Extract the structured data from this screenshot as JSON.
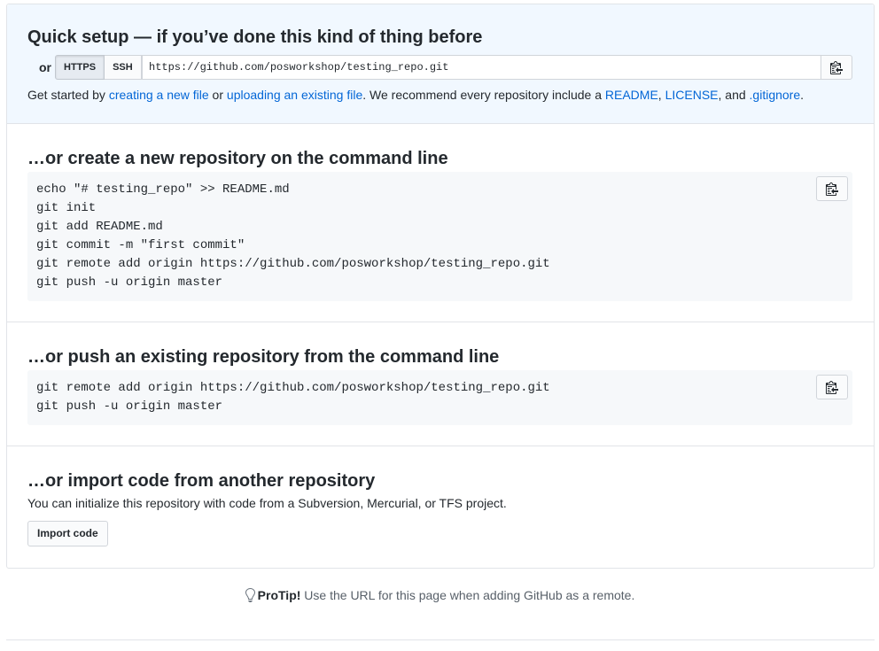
{
  "quick_setup": {
    "title": "Quick setup — if you’ve done this kind of thing before",
    "or_label": "or",
    "https_label": "HTTPS",
    "ssh_label": "SSH",
    "clone_url": "https://github.com/posworkshop/testing_repo.git",
    "get_started": {
      "prefix": "Get started by ",
      "new_file_link": "creating a new file",
      "or_text": " or ",
      "upload_link": "uploading an existing file",
      "recommend_text": ". We recommend every repository include a ",
      "readme_link": "README",
      "comma1": ", ",
      "license_link": "LICENSE",
      "and_text": ", and ",
      "gitignore_link": ".gitignore",
      "period": "."
    }
  },
  "create_section": {
    "title": "…or create a new repository on the command line",
    "code": "echo \"# testing_repo\" >> README.md\ngit init\ngit add README.md\ngit commit -m \"first commit\"\ngit remote add origin https://github.com/posworkshop/testing_repo.git\ngit push -u origin master"
  },
  "push_section": {
    "title": "…or push an existing repository from the command line",
    "code": "git remote add origin https://github.com/posworkshop/testing_repo.git\ngit push -u origin master"
  },
  "import_section": {
    "title": "…or import code from another repository",
    "description": "You can initialize this repository with code from a Subversion, Mercurial, or TFS project.",
    "button_label": "Import code"
  },
  "protip": {
    "label": "ProTip!",
    "text": " Use the URL for this page when adding GitHub as a remote."
  },
  "icons": {
    "copy": "clipboard-icon",
    "tip": "light-bulb-icon"
  },
  "colors": {
    "link": "#0366d6",
    "quick_setup_bg": "#f1f8ff",
    "code_bg": "#f6f8fa",
    "border": "#e1e4e8"
  }
}
